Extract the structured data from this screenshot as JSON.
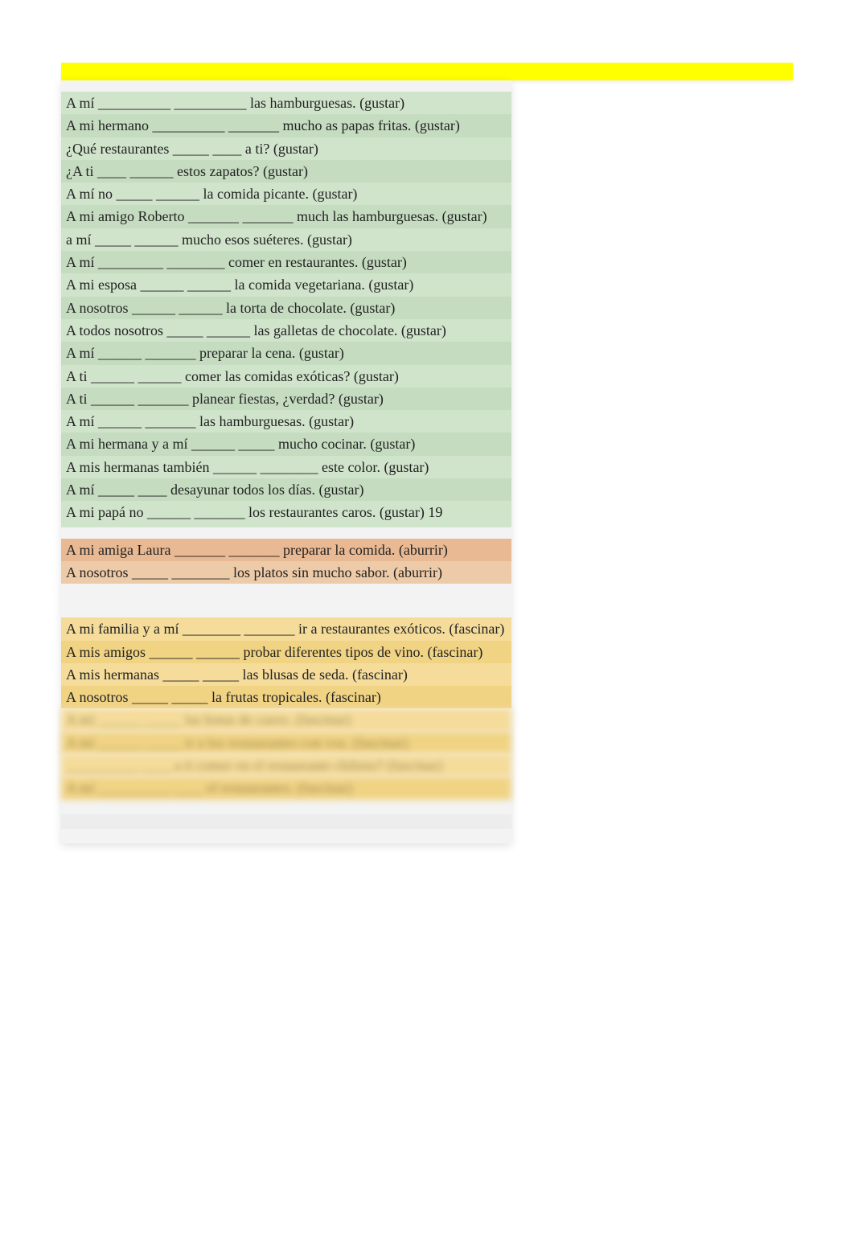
{
  "sections": {
    "gustar": [
      "A mí __________ __________ las hamburguesas. (gustar)",
      "A mi hermano __________ _______ mucho as papas fritas. (gustar)",
      "¿Qué restaurantes _____ ____ a ti? (gustar)",
      "¿A ti ____ ______ estos zapatos? (gustar)",
      "A mí no _____ ______ la comida picante. (gustar)",
      "A mi amigo Roberto _______ _______ much las hamburguesas. (gustar)",
      "a mí _____ ______ mucho esos suéteres. (gustar)",
      "A mí _________ ________ comer en restaurantes. (gustar)",
      "A mi esposa ______ ______ la comida vegetariana. (gustar)",
      "A nosotros ______ ______ la torta de chocolate. (gustar)",
      "A todos nosotros _____ ______ las galletas de chocolate. (gustar)",
      "A mí ______ _______ preparar la cena. (gustar)",
      "A ti ______ ______ comer las comidas exóticas? (gustar)",
      "A ti ______ _______ planear fiestas, ¿verdad? (gustar)",
      "A mí ______ _______ las hamburguesas. (gustar)",
      "A mi hermana y a mí ______ _____ mucho cocinar. (gustar)",
      "A mis hermanas también ______ ________ este color. (gustar)",
      "A mí _____ ____ desayunar todos los días. (gustar)",
      "A mi papá no ______ _______ los restaurantes caros. (gustar) 19"
    ],
    "aburrir": [
      "A mi amiga Laura _______ _______ preparar la comida. (aburrir)",
      "A nosotros _____ ________ los platos sin mucho sabor. (aburrir)"
    ],
    "fascinar_visible": [
      "A mi familia y a mí ________ _______ ir a restaurantes exóticos. (fascinar)",
      "A mis amigos ______ ______ probar diferentes tipos de vino. (fascinar)",
      "A mis hermanas _____ _____ las blusas de seda. (fascinar)",
      "A nosotros _____ _____ la frutas tropicales. (fascinar)"
    ],
    "fascinar_hidden": [
      "A mí ______ _____ las botas de cuero. (fascinar)",
      "A mí ______ _____ ir a los restaurantes con vos. (fascinar)",
      "__________ ____ a ti comer en el restaurante chileno? (fascinar)",
      "A mí __________ ____ el restaurantes. (fascinar)"
    ]
  }
}
